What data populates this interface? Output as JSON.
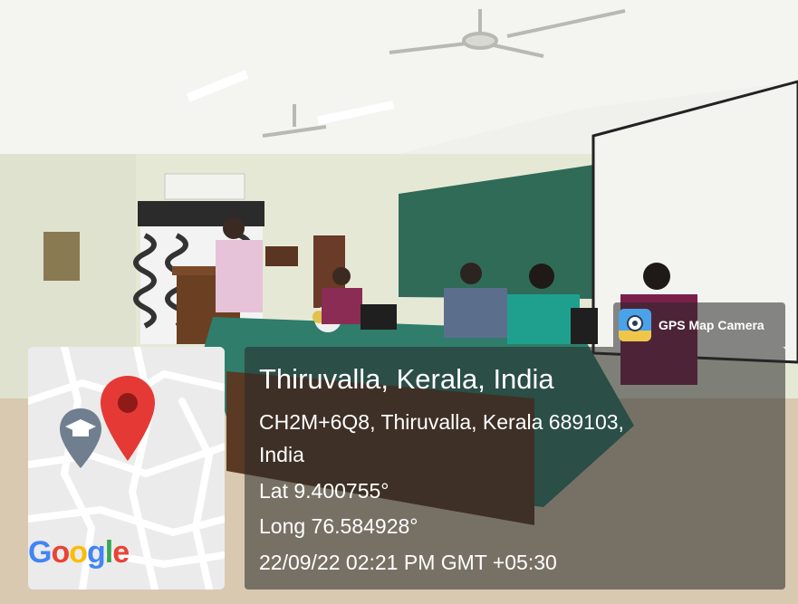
{
  "badge": {
    "app_name": "GPS Map Camera",
    "icon": "gps-map-camera-logo-icon"
  },
  "stamp": {
    "place": "Thiruvalla, Kerala, India",
    "address_line1": "CH2M+6Q8, Thiruvalla, Kerala 689103,",
    "address_line2": "India",
    "latitude": "Lat 9.400755°",
    "longitude": "Long 76.584928°",
    "timestamp": "22/09/22 02:21 PM GMT +05:30"
  },
  "map": {
    "brand": [
      "G",
      "o",
      "o",
      "g",
      "l",
      "e"
    ],
    "brand_colors": [
      "#4285F4",
      "#EA4335",
      "#FBBC05",
      "#4285F4",
      "#34A853",
      "#EA4335"
    ],
    "pin_icon": "location-pin-icon",
    "poi_icon": "graduation-cap-icon"
  },
  "colors": {
    "table_cloth": "#2f7d6a",
    "chalkboard": "#2f6b57",
    "wall": "#e9ead8",
    "pin_red": "#e53935"
  }
}
